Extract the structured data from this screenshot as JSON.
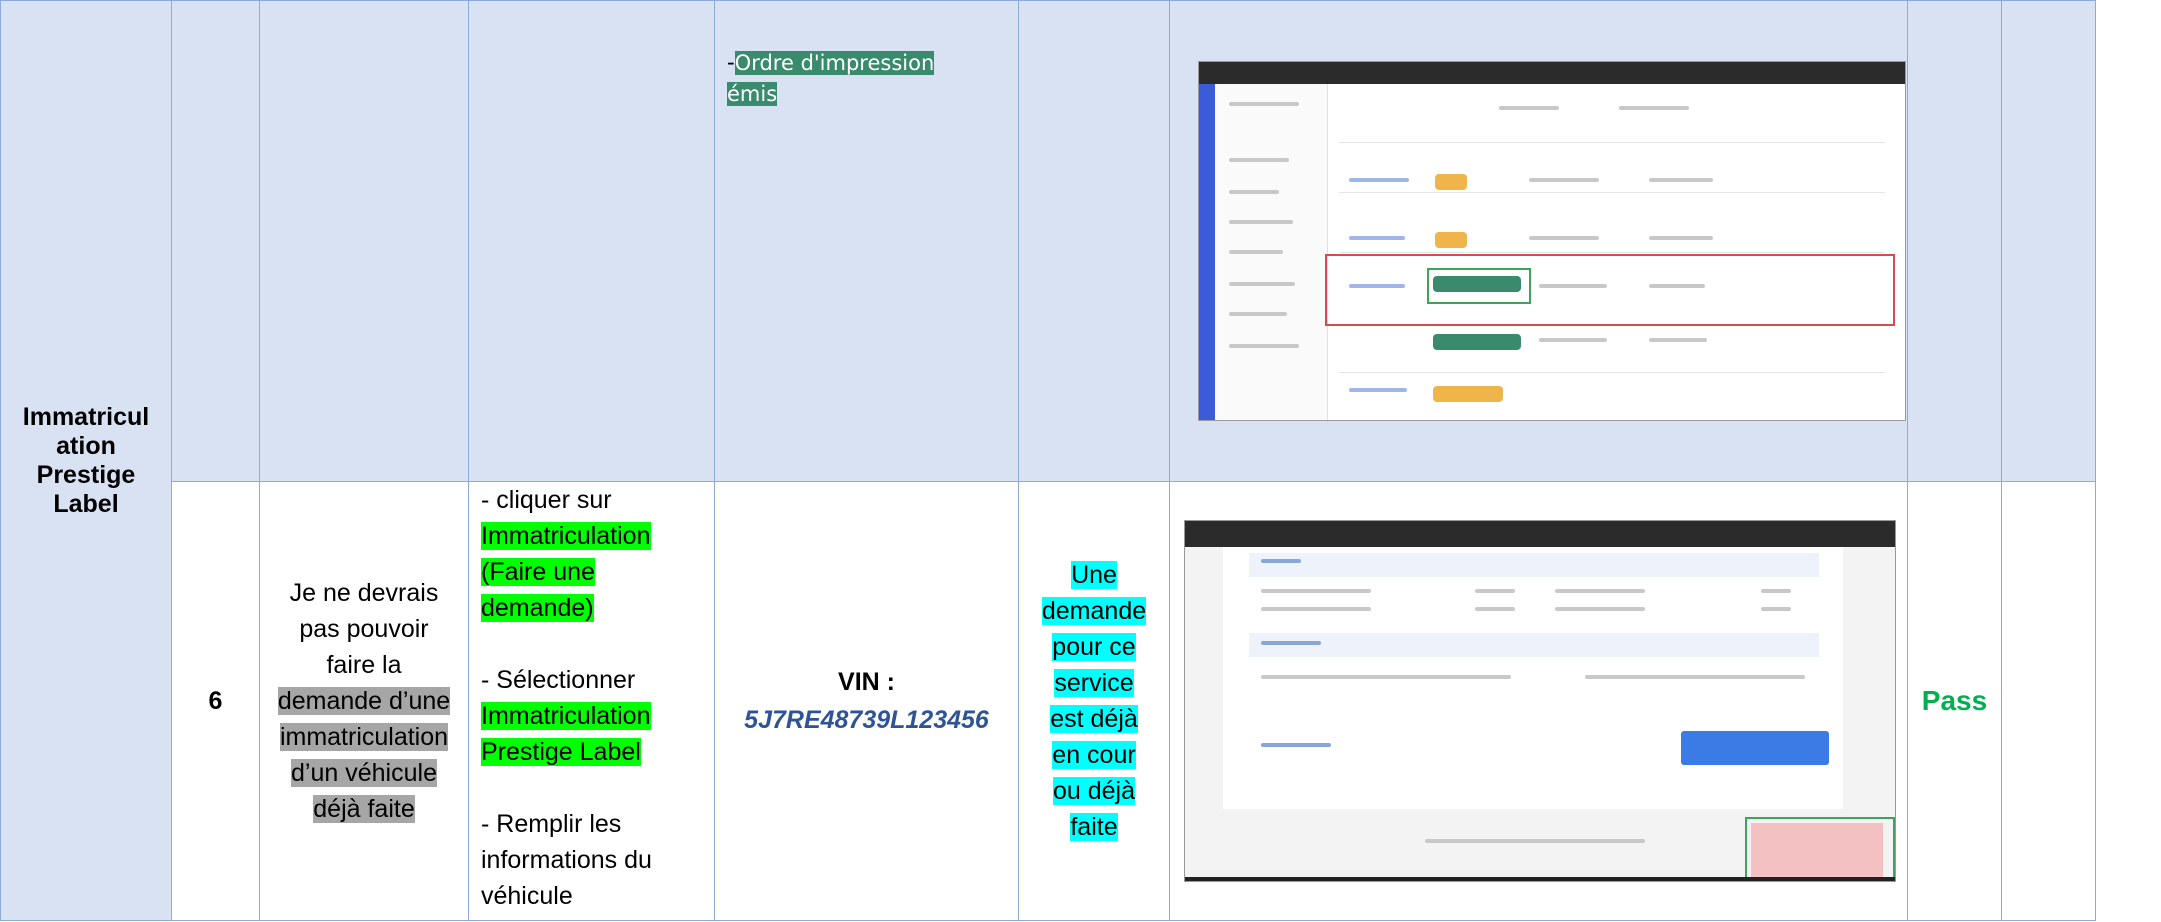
{
  "row_upper": {
    "action_text": "Ordre d'impression émis"
  },
  "row_main": {
    "feature": [
      "Immatricul",
      "ation",
      "Prestige",
      "Label"
    ],
    "test_number": "6",
    "scenario": {
      "part1": "Je ne devrais pas pouvoir faire la",
      "part2": "demande d’une immatriculation d’un véhicule déjà faite"
    },
    "steps": {
      "s1_prefix": "- cliquer sur",
      "s1_highlight": "Immatriculation (Faire une demande)",
      "s2_prefix": "- Sélectionner",
      "s2_highlight": "Immatriculation Prestige Label",
      "s3": "- Remplir les informations du véhicule"
    },
    "data": {
      "vin_label": "VIN :",
      "vin_value": "5J7RE48739L123456"
    },
    "expected": "Une demande pour ce service est déjà en cour ou déjà faite",
    "result": "Pass"
  },
  "colors": {
    "header_bg": "#d9e2f3",
    "border": "#8eaadb",
    "pass": "#00b050",
    "vin": "#2f5496",
    "highlight_green": "#00ff00",
    "highlight_cyan": "#00ffff",
    "highlight_grey": "#a6a6a6",
    "highlight_teal": "#3a8a6e"
  }
}
